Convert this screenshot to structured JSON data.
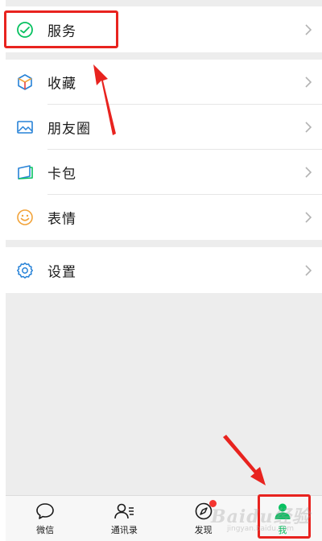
{
  "menu": {
    "service_label": "服务",
    "favorites_label": "收藏",
    "moments_label": "朋友圈",
    "cards_label": "卡包",
    "stickers_label": "表情",
    "settings_label": "设置"
  },
  "tabbar": {
    "chats_label": "微信",
    "contacts_label": "通讯录",
    "discover_label": "发现",
    "me_label": "我"
  },
  "watermark": {
    "text": "Baidu经验",
    "sub": "jingyan.baidu.com"
  },
  "colors": {
    "accent_green": "#07c160",
    "highlight_red": "#e8231f",
    "badge_red": "#f43530",
    "background_gray": "#ededed"
  },
  "icons": {
    "service": "service-icon",
    "favorites": "favorites-cube-icon",
    "moments": "moments-photo-icon",
    "cards": "card-wallet-icon",
    "stickers": "smiley-icon",
    "settings": "gear-icon",
    "chats": "chat-bubble-icon",
    "contacts": "contacts-icon",
    "discover": "compass-icon",
    "me": "person-icon"
  }
}
